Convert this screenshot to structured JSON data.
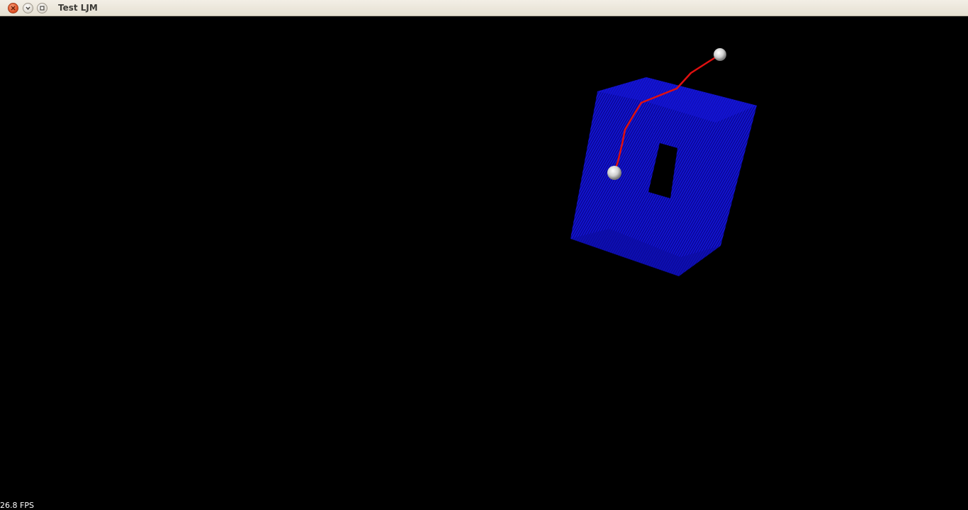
{
  "window": {
    "title": "Test LJM",
    "controls": {
      "close_icon": "close-icon",
      "minimize_icon": "chevron-down-icon",
      "maximize_icon": "maximize-icon"
    }
  },
  "scene": {
    "object_color": "#1010ee",
    "path_color": "#e01010",
    "sphere_color": "#e8e8e8",
    "background": "#000000"
  },
  "status": {
    "fps": "26.8 FPS"
  }
}
